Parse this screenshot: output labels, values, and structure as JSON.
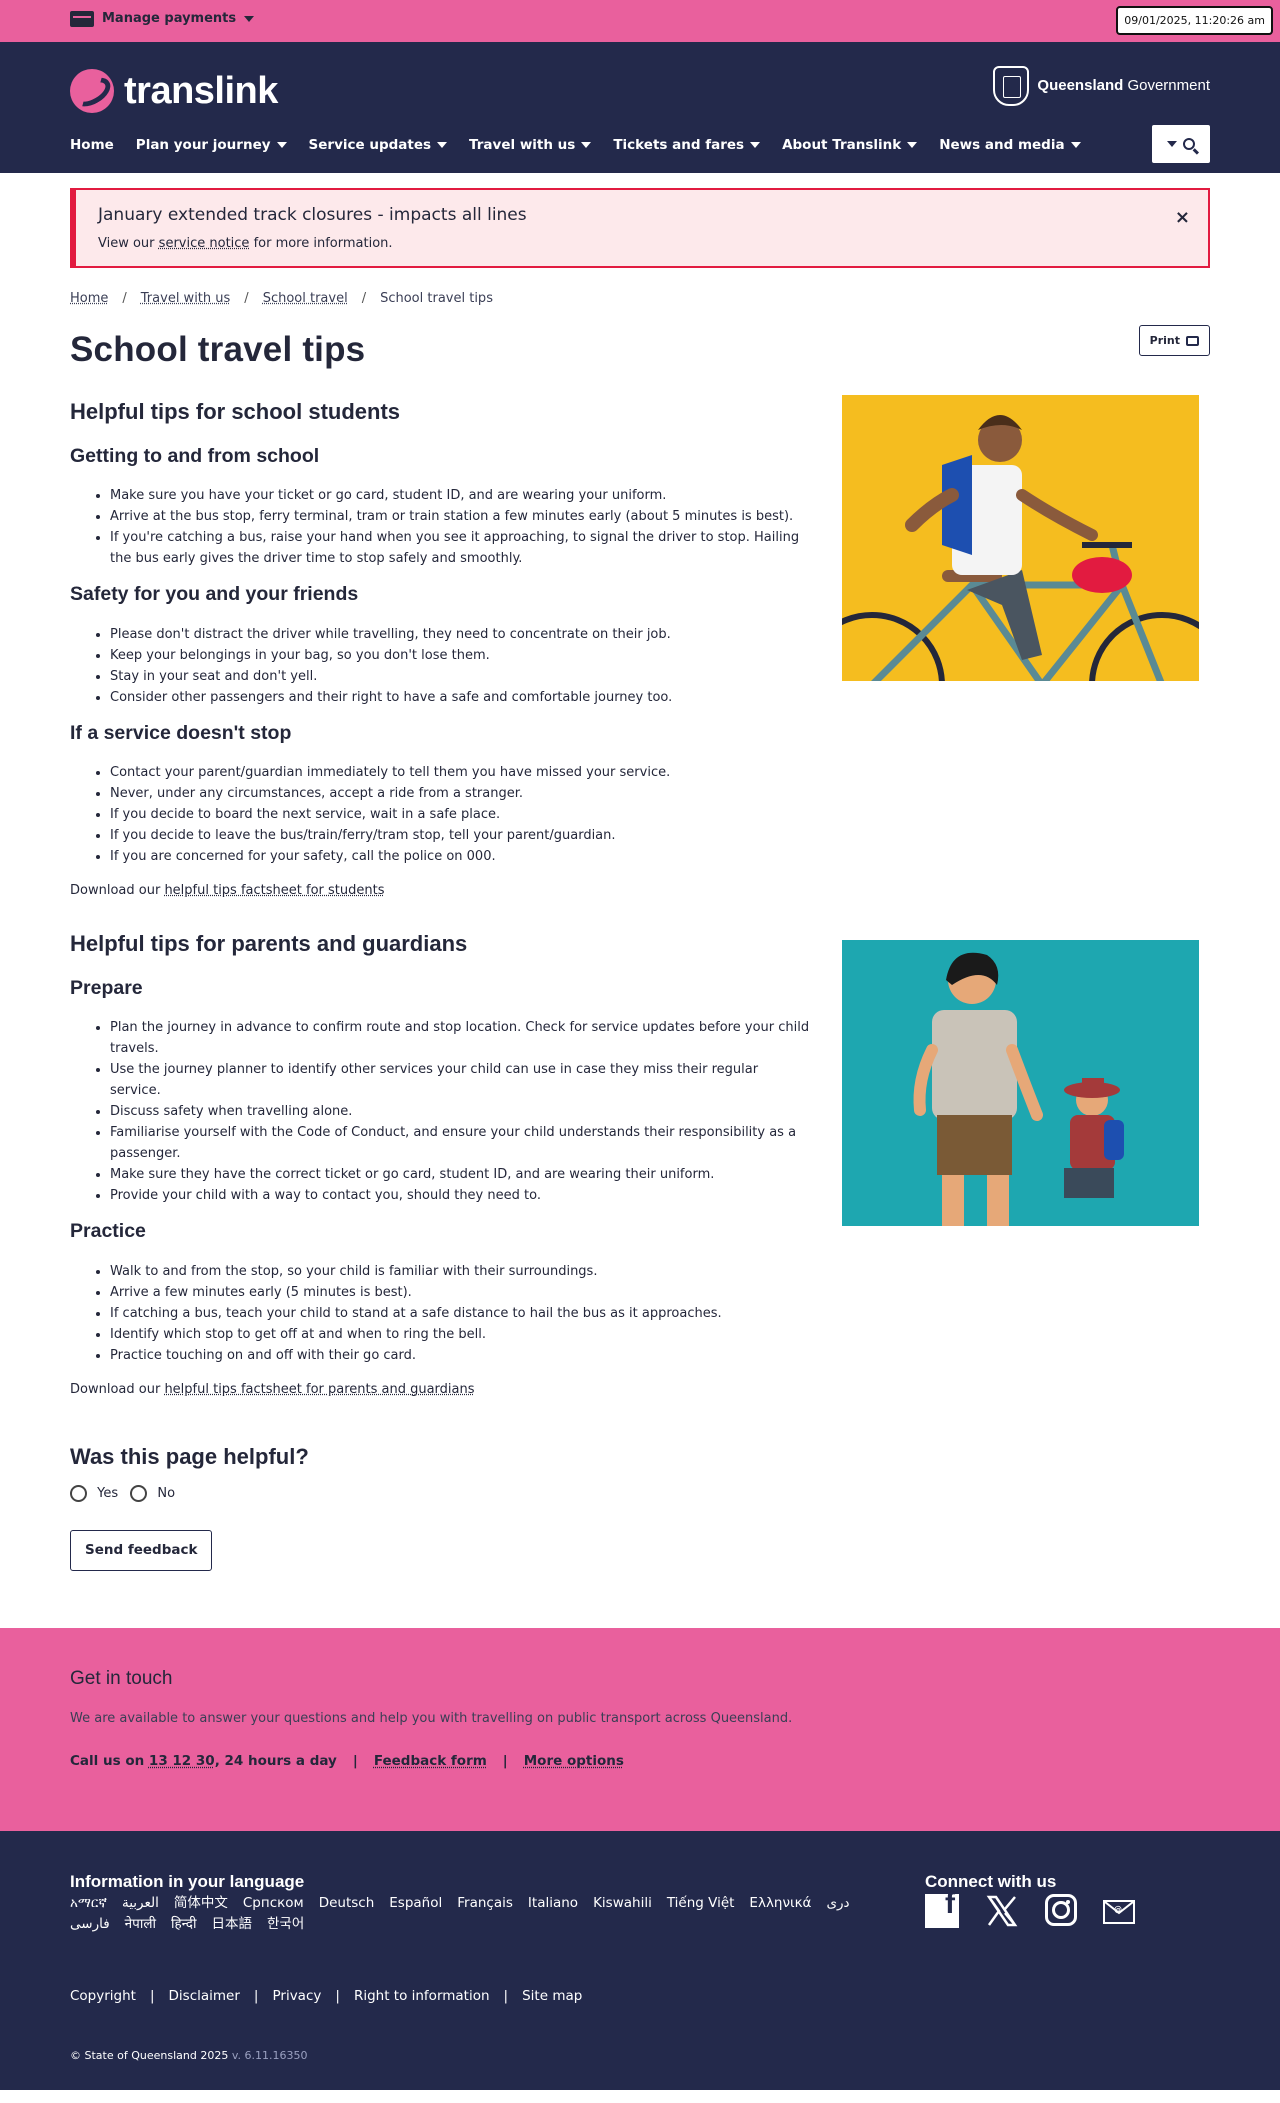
{
  "topbar": {
    "manage_label": "Manage payments",
    "timestamp": "09/01/2025, 11:20:26 am"
  },
  "header": {
    "logo_text": "translink",
    "gov_bold": "Queensland",
    "gov_regular": "Government",
    "nav": [
      "Home",
      "Plan your journey",
      "Service updates",
      "Travel with us",
      "Tickets and fares",
      "About Translink",
      "News and media"
    ]
  },
  "alert": {
    "title": "January extended track closures - impacts all lines",
    "body_before": "View our",
    "body_link": "service notice",
    "body_after": "for more information.",
    "close": "×"
  },
  "breadcrumb": [
    "Home",
    "Travel with us",
    "School travel",
    "School travel tips"
  ],
  "page": {
    "title": "School travel tips",
    "print_label": "Print"
  },
  "students": {
    "heading": "Helpful tips for school students",
    "getting": {
      "heading": "Getting to and from school",
      "items": [
        "Make sure you have your ticket or go card, student ID, and are wearing your uniform.",
        "Arrive at the bus stop, ferry terminal, tram or train station a few minutes early (about 5 minutes is best).",
        "If you're catching a bus, raise your hand when you see it approaching, to signal the driver to stop. Hailing the bus early gives the driver time to stop safely and smoothly."
      ]
    },
    "safety": {
      "heading": "Safety for you and your friends",
      "items": [
        "Please don't distract the driver while travelling, they need to concentrate on their job.",
        "Keep your belongings in your bag, so you don't lose them.",
        "Stay in your seat and don't yell.",
        "Consider other passengers and their right to have a safe and comfortable journey too."
      ]
    },
    "nostop": {
      "heading": "If a service doesn't stop",
      "items": [
        "Contact your parent/guardian immediately to tell them you have missed your service.",
        "Never, under any circumstances, accept a ride from a stranger.",
        "If you decide to board the next service, wait in a safe place.",
        "If you decide to leave the bus/train/ferry/tram stop, tell your parent/guardian.",
        "If you are concerned for your safety, call the police on 000."
      ]
    },
    "download_before": "Download our",
    "download_link": "helpful tips factsheet for students"
  },
  "parents": {
    "heading": "Helpful tips for parents and guardians",
    "prepare": {
      "heading": "Prepare",
      "items": [
        "Plan the journey in advance to confirm route and stop location. Check for service updates before your child travels.",
        "Use the journey planner to identify other services your child can use in case they miss their regular service.",
        "Discuss safety when travelling alone.",
        "Familiarise yourself with the Code of Conduct, and ensure your child understands their responsibility as a passenger.",
        "Make sure they have the correct ticket or go card, student ID, and are wearing their uniform.",
        "Provide your child with a way to contact you, should they need to."
      ]
    },
    "practice": {
      "heading": "Practice",
      "items": [
        "Walk to and from the stop, so your child is familiar with their surroundings.",
        "Arrive a few minutes early (5 minutes is best).",
        "If catching a bus, teach your child to stand at a safe distance to hail the bus as it approaches.",
        "Identify which stop to get off at and when to ring the bell.",
        "Practice touching on and off with their go card."
      ]
    },
    "download_before": "Download our",
    "download_link": "helpful tips factsheet for parents and guardians"
  },
  "feedback": {
    "heading": "Was this page helpful?",
    "yes": "Yes",
    "no": "No",
    "button": "Send feedback"
  },
  "get_in_touch": {
    "heading": "Get in touch",
    "text": "We are available to answer your questions and help you with travelling on public transport across Queensland.",
    "call_before": "Call us on",
    "call_number": "13 12 30",
    "call_after": ", 24 hours a day",
    "feedback_link": "Feedback form",
    "more_link": "More options",
    "sep": "|"
  },
  "footer": {
    "lang_heading": "Information in your language",
    "languages": [
      "አማርኛ",
      "العربية",
      "简体中文",
      "Српском",
      "Deutsch",
      "Español",
      "Français",
      "Italiano",
      "Kiswahili",
      "Tiếng Việt",
      "Ελληνικά",
      "دری",
      "فارسی",
      "नेपाली",
      "हिन्दी",
      "日本語",
      "한국어"
    ],
    "connect_heading": "Connect with us",
    "legal": [
      "Copyright",
      "Disclaimer",
      "Privacy",
      "Right to information",
      "Site map"
    ],
    "legal_sep": "|",
    "copyright": "© State of Queensland 2025",
    "version": "v. 6.11.16350"
  },
  "colors": {
    "pink": "#e9609d",
    "navy": "#23294b",
    "alert_red": "#e21b40",
    "yellow": "#f5bd1f",
    "teal": "#1ea7b0"
  },
  "icons": [
    "payment-card-icon",
    "chevron-down-icon",
    "search-icon",
    "close-icon",
    "printer-icon",
    "facebook-icon",
    "x-icon",
    "instagram-icon",
    "email-icon"
  ]
}
